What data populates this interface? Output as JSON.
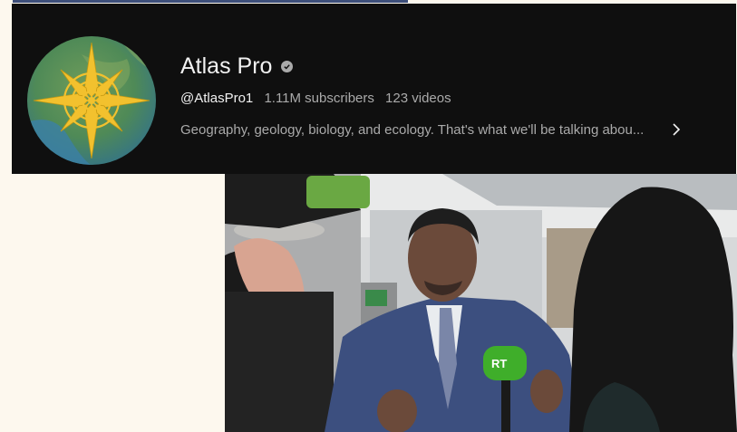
{
  "channel": {
    "name": "Atlas Pro",
    "handle": "@AtlasPro1",
    "subscribers": "1.11M subscribers",
    "videos": "123 videos",
    "description": "Geography, geology, biology, and ecology. That's what we'll be talking abou...",
    "verified_icon": "verified-check-icon",
    "expand_icon": "chevron-right-icon"
  },
  "photo": {
    "microphone_logo": "RT"
  },
  "colors": {
    "header_bg": "#0f0f0f",
    "text_primary": "#f1f1f1",
    "text_secondary": "#aaaaaa",
    "page_bg": "#fdf8ee",
    "avatar_compass": "#f2c12e",
    "mic_green": "#3fae2a"
  }
}
